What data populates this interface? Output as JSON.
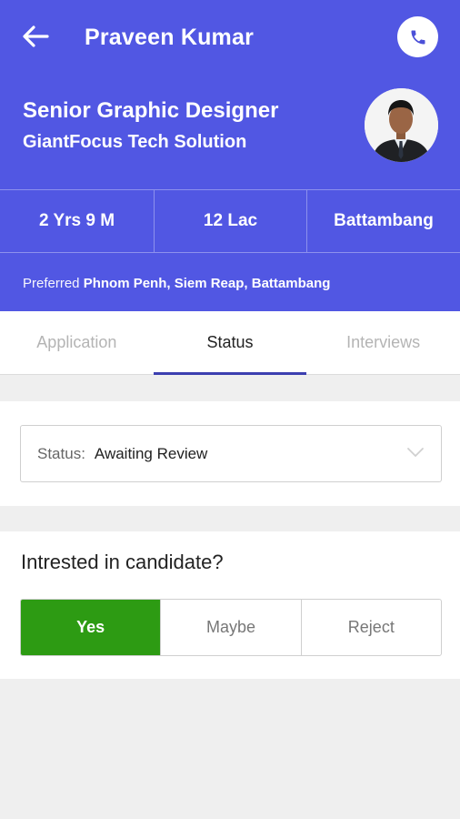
{
  "header": {
    "title": "Praveen Kumar",
    "job_title": "Senior Graphic Designer",
    "company": "GiantFocus Tech Solution",
    "stats": [
      "2 Yrs 9 M",
      "12 Lac",
      "Battambang"
    ],
    "preferred_label": "Preferred",
    "preferred_locations": "Phnom Penh, Siem Reap, Battambang",
    "accent_color": "#5157e3"
  },
  "tabs": [
    {
      "label": "Application",
      "active": false
    },
    {
      "label": "Status",
      "active": true
    },
    {
      "label": "Interviews",
      "active": false
    }
  ],
  "status": {
    "label": "Status:",
    "value": "Awaiting Review"
  },
  "interest": {
    "question": "Intrested in candidate?",
    "options": [
      "Yes",
      "Maybe",
      "Reject"
    ],
    "selected": "Yes",
    "selected_color": "#2d9b13"
  },
  "icons": {
    "back": "arrow-left-icon",
    "call": "phone-icon",
    "dropdown": "chevron-down-icon"
  }
}
